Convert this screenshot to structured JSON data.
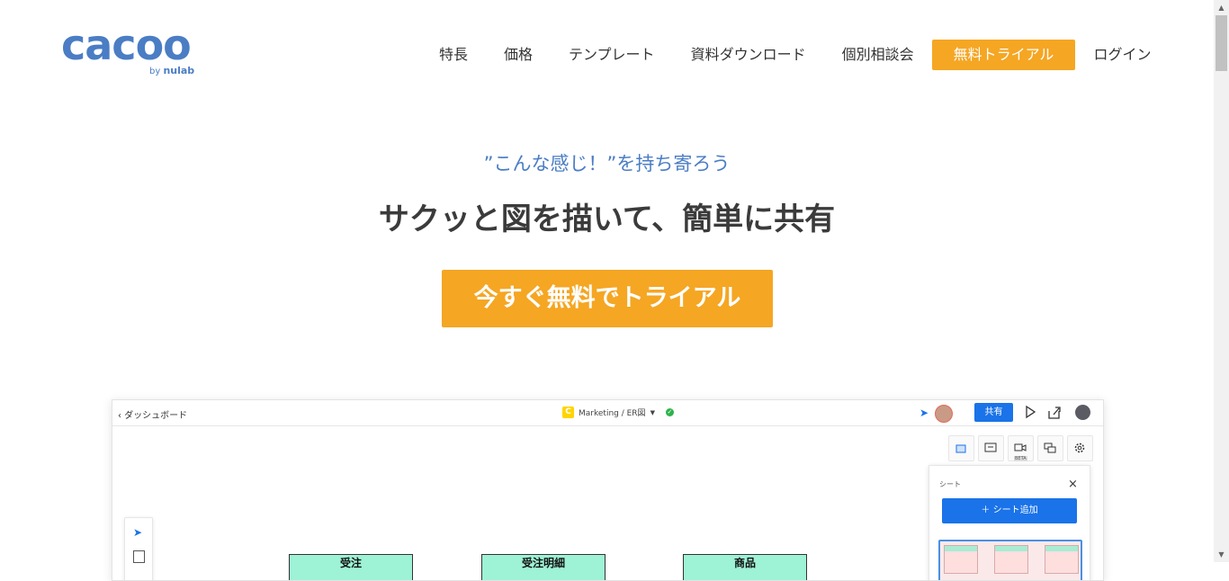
{
  "header": {
    "logo_word": "cacoo",
    "logo_by": "by",
    "logo_nulab": "nulab",
    "nav": [
      "特長",
      "価格",
      "テンプレート",
      "資料ダウンロード",
      "個別相談会"
    ],
    "cta": "無料トライアル",
    "login": "ログイン"
  },
  "hero": {
    "tagline": "”こんな感じ！”を持ち寄ろう",
    "headline": "サクッと図を描いて、簡単に共有",
    "cta": "今すぐ無料でトライアル"
  },
  "app": {
    "back": "‹ ダッシュボード",
    "doc_icon": "C",
    "doc_title": "Marketing / ER図",
    "share": "共有",
    "tools": [
      "sheets-icon",
      "comment-icon",
      "video-icon",
      "chat-icon",
      "gear-icon"
    ],
    "beta": "BETA",
    "sheet_panel": {
      "title": "シート",
      "close": "×",
      "add": "＋ シート追加"
    },
    "entities": [
      "受注",
      "受注明細",
      "商品"
    ]
  },
  "colors": {
    "accent": "#f5a623",
    "brand": "#4a7dc4",
    "primary": "#1a73e8",
    "entity": "#9ef2d6"
  }
}
